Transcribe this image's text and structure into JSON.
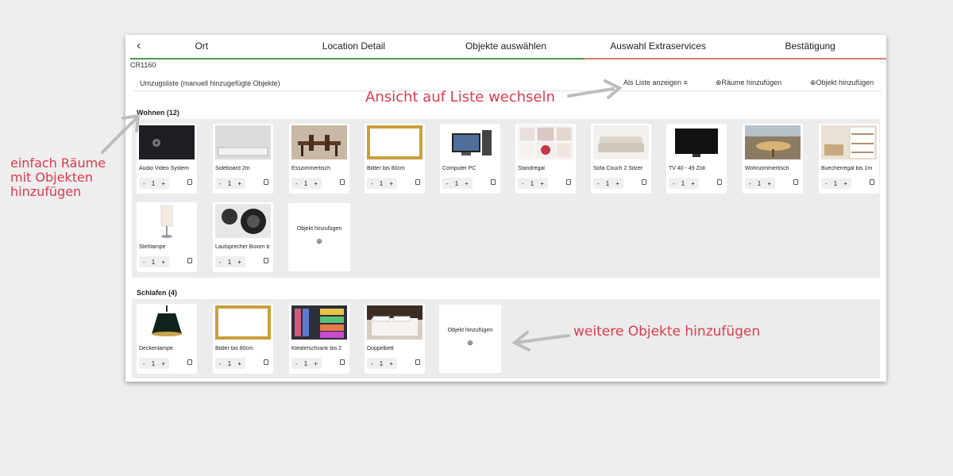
{
  "header": {
    "back_icon": "chevron-left-icon",
    "steps": [
      "Ort",
      "Location Detail",
      "Objekte auswählen",
      "Auswahl Extraservices",
      "Bestätigung"
    ],
    "code": "CR1160",
    "progress_done_color": "#4a9a4a",
    "progress_todo_color": "#e07a7a"
  },
  "listbar": {
    "title": "Umzugsliste (manuell hinzugefügte Objekte)",
    "view_list": "Als Liste anzeigen",
    "add_rooms": "Räume hinzufügen",
    "add_object": "Objekt hinzufügen"
  },
  "rooms": [
    {
      "title": "Wohnen (12)",
      "items": [
        {
          "name": "Audio Video System",
          "qty": "1"
        },
        {
          "name": "Sideboard 2m",
          "qty": "1"
        },
        {
          "name": "Esszimmertisch",
          "qty": "1"
        },
        {
          "name": "Bilder bis 80cm",
          "qty": "1"
        },
        {
          "name": "Computer PC",
          "qty": "1"
        },
        {
          "name": "Standregal",
          "qty": "1"
        },
        {
          "name": "Sofa Couch 2 Sitzer",
          "qty": "1"
        },
        {
          "name": "TV 40 - 49 Zoll",
          "qty": "1"
        },
        {
          "name": "Wohnzimmertisch",
          "qty": "1"
        },
        {
          "name": "Buecherregal bis 1m",
          "qty": "1"
        },
        {
          "name": "Stehlampe",
          "qty": "1"
        },
        {
          "name": "Lautsprecher Boxen b",
          "qty": "1"
        }
      ],
      "add_label": "Objekt hinzufügen"
    },
    {
      "title": "Schlafen (4)",
      "items": [
        {
          "name": "Deckenlampe",
          "qty": "1"
        },
        {
          "name": "Bilder bis 80cm",
          "qty": "1"
        },
        {
          "name": "Kleiderschrank bis 2",
          "qty": "1"
        },
        {
          "name": "Doppelbett",
          "qty": "1"
        }
      ],
      "add_label": "Objekt hinzufügen"
    }
  ],
  "stepper": {
    "minus": "-",
    "plus": "+"
  },
  "annotations": {
    "view_list": "Ansicht auf Liste wechseln",
    "rooms": "einfach Räume mit Objekten hinzufügen",
    "more": "weitere Objekte hinzufügen",
    "color": "#dc3b4e"
  }
}
